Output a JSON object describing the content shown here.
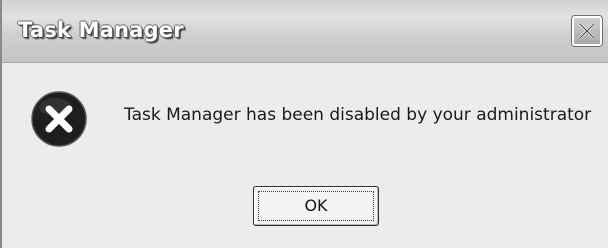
{
  "dialog": {
    "title": "Task Manager",
    "message": "Task Manager has been disabled by your administrator",
    "ok_label": "OK",
    "close_icon": "close-icon",
    "status_icon": "error-icon"
  },
  "colors": {
    "titlebar": "#c8c8c8",
    "body_background": "#ececec",
    "icon_fill": "#1e1e1e",
    "icon_mark": "#ffffff"
  }
}
